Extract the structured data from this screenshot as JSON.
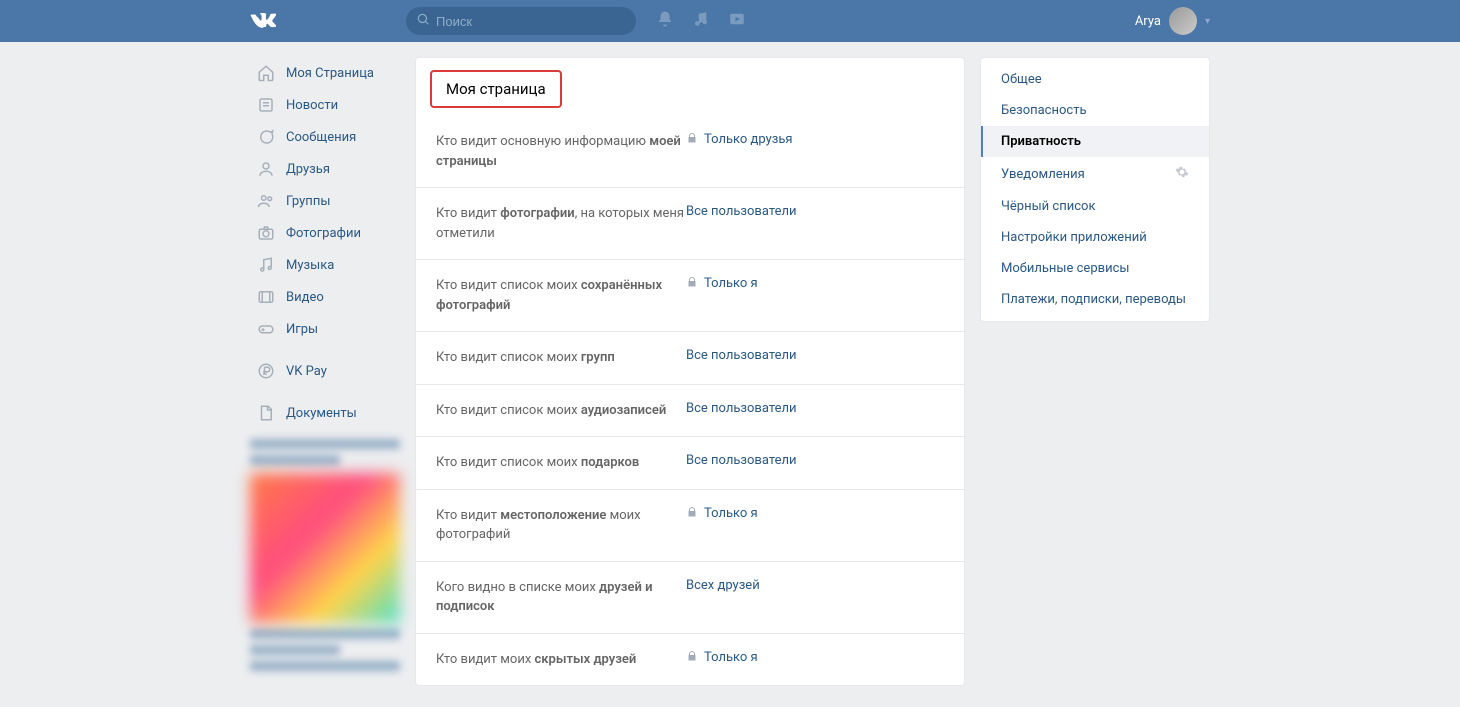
{
  "header": {
    "search_placeholder": "Поиск",
    "username": "Arya"
  },
  "leftnav": {
    "items": [
      {
        "label": "Моя Страница"
      },
      {
        "label": "Новости"
      },
      {
        "label": "Сообщения"
      },
      {
        "label": "Друзья"
      },
      {
        "label": "Группы"
      },
      {
        "label": "Фотографии"
      },
      {
        "label": "Музыка"
      },
      {
        "label": "Видео"
      },
      {
        "label": "Игры"
      }
    ],
    "vkpay": "VK Pay",
    "documents": "Документы"
  },
  "section": {
    "title": "Моя страница"
  },
  "settings": [
    {
      "label_pre": "Кто видит основную информацию ",
      "label_bold": "моей страницы",
      "value": "Только друзья",
      "lock": true
    },
    {
      "label_pre": "Кто видит ",
      "label_bold": "фотографии",
      "label_post": ", на которых меня отметили",
      "value": "Все пользователи",
      "lock": false
    },
    {
      "label_pre": "Кто видит список моих ",
      "label_bold": "сохранённых фотографий",
      "value": "Только я",
      "lock": true
    },
    {
      "label_pre": "Кто видит список моих ",
      "label_bold": "групп",
      "value": "Все пользователи",
      "lock": false
    },
    {
      "label_pre": "Кто видит список моих ",
      "label_bold": "аудиозаписей",
      "value": "Все пользователи",
      "lock": false
    },
    {
      "label_pre": "Кто видит список моих ",
      "label_bold": "подарков",
      "value": "Все пользователи",
      "lock": false
    },
    {
      "label_pre": "Кто видит ",
      "label_bold": "местоположение",
      "label_post": " моих фотографий",
      "value": "Только я",
      "lock": true
    },
    {
      "label_pre": "Кого видно в списке моих ",
      "label_bold": "друзей и подписок",
      "value": "Всех друзей",
      "lock": false
    },
    {
      "label_pre": "Кто видит моих ",
      "label_bold": "скрытых друзей",
      "value": "Только я",
      "lock": true
    }
  ],
  "rightnav": {
    "items": [
      {
        "label": "Общее",
        "active": false,
        "gear": false
      },
      {
        "label": "Безопасность",
        "active": false,
        "gear": false
      },
      {
        "label": "Приватность",
        "active": true,
        "gear": false
      },
      {
        "label": "Уведомления",
        "active": false,
        "gear": true
      },
      {
        "label": "Чёрный список",
        "active": false,
        "gear": false
      },
      {
        "label": "Настройки приложений",
        "active": false,
        "gear": false
      },
      {
        "label": "Мобильные сервисы",
        "active": false,
        "gear": false
      },
      {
        "label": "Платежи, подписки, переводы",
        "active": false,
        "gear": false
      }
    ]
  }
}
